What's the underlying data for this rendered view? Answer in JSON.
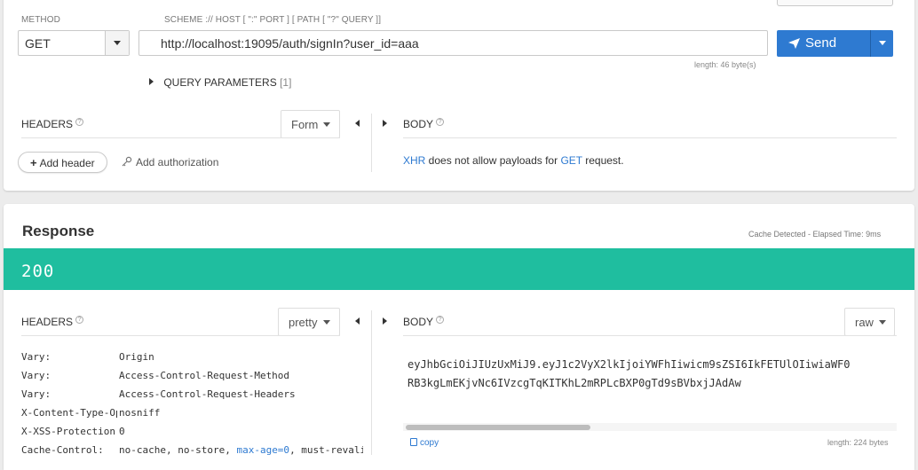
{
  "request": {
    "method_label": "METHOD",
    "method_value": "GET",
    "url_label": "SCHEME :// HOST [ \":\" PORT ] [ PATH [ \"?\" QUERY ]]",
    "url_value": "http://localhost:19095/auth/signIn?user_id=aaa",
    "url_length": "length: 46 byte(s)",
    "send_label": "Send",
    "query_params_label": "QUERY PARAMETERS",
    "query_params_count": "[1]",
    "headers_title": "HEADERS",
    "headers_mode": "Form",
    "add_header_label": "Add header",
    "add_auth_label": "Add authorization",
    "body_title": "BODY",
    "body_note": {
      "xhr": "XHR",
      "middle": " does not allow payloads for ",
      "method": "GET",
      "end": " request."
    }
  },
  "response": {
    "title": "Response",
    "elapsed": "Cache Detected - Elapsed Time: 9ms",
    "status": "200",
    "status_color": "#1fbe9f",
    "headers_title": "HEADERS",
    "headers_mode": "pretty",
    "headers": [
      {
        "name": "Vary:",
        "value": "Origin"
      },
      {
        "name": "Vary:",
        "value": "Access-Control-Request-Method"
      },
      {
        "name": "Vary:",
        "value": "Access-Control-Request-Headers"
      },
      {
        "name": "X-Content-Type-Options:",
        "value": "nosniff"
      },
      {
        "name": "X-XSS-Protection:",
        "value": "0"
      },
      {
        "name": "Cache-Control:",
        "value_pre": "no-cache, no-store, ",
        "value_link": "max-age=0",
        "value_post": ", must-revalidate"
      }
    ],
    "body_title": "BODY",
    "body_mode": "raw",
    "body_line1": "eyJhbGciOiJIUzUxMiJ9.eyJ1c2VyX2lkIjoiYWFhIiwicm9sZSI6IkFETUlOIiwiaWF0",
    "body_line2": "RB3kgLmEKjvNc6IVzcgTqKITKhL2mRPLcBXP0gTd9sBVbxjJAdAw",
    "copy_label": "copy",
    "body_length": "length: 224 bytes"
  },
  "colors": {
    "accent": "#2e7ad1",
    "status_ok": "#1fbe9f"
  }
}
